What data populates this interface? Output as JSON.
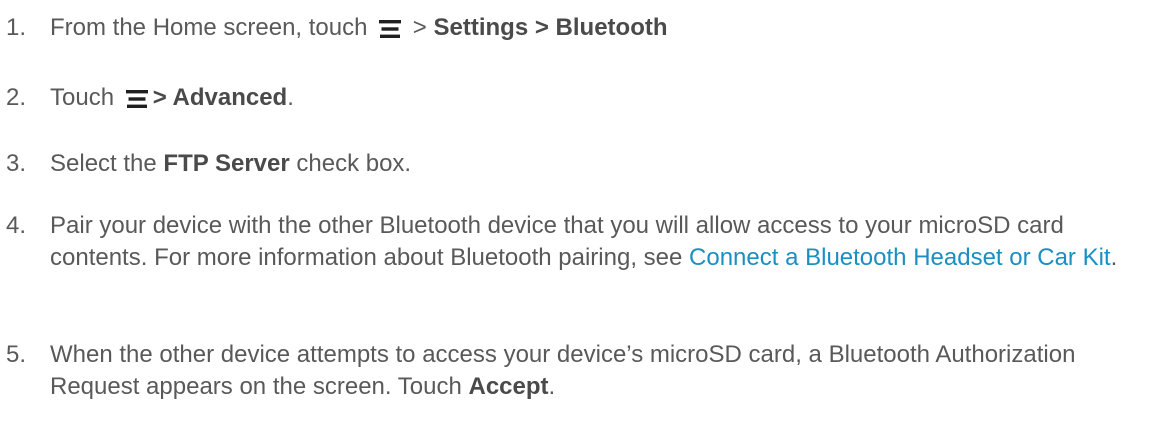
{
  "steps": [
    {
      "number": "1.",
      "intro": "From the Home screen, touch",
      "after_icon": " > ",
      "path": "Settings > Bluetooth"
    },
    {
      "number": "2.",
      "intro": "Touch",
      "path": "> Advanced",
      "end": "."
    },
    {
      "number": "3.",
      "intro": "Select the ",
      "bold": "FTP Server",
      "end": " check box."
    },
    {
      "number": "4.",
      "text": "Pair your device with the other Bluetooth device that you will allow access to your microSD card contents. For more information about Bluetooth pairing, see ",
      "link": "Connect a Bluetooth Headset or Car Kit",
      "end": "."
    },
    {
      "number": "5.",
      "text": "When the other device attempts to access your device’s microSD card, a Bluetooth Authorization Request appears on the screen. Touch ",
      "bold": "Accept",
      "end": "."
    }
  ],
  "icons": {
    "menu": "menu-icon"
  },
  "colors": {
    "text": "#595959",
    "link": "#1a8fc2",
    "icon": "#1f1f1f"
  }
}
